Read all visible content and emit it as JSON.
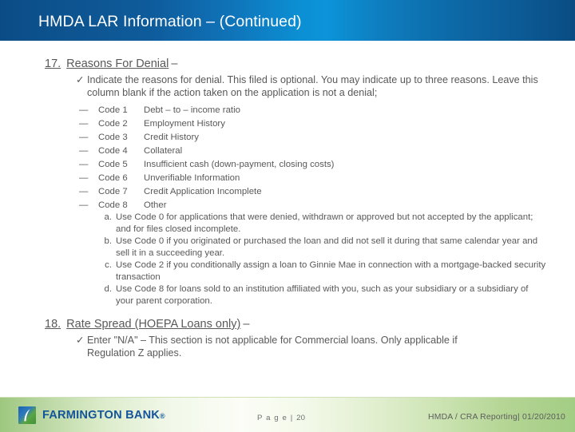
{
  "slide": {
    "title": "HMDA LAR Information – (Continued)"
  },
  "items": [
    {
      "number": "17.",
      "title": "Reasons For Denial",
      "dash": "–",
      "bullet_icon": "check-icon",
      "bullet": "Indicate the reasons for denial.  This filed is optional. You may indicate up to three reasons. Leave this column blank if the action taken on the application is not a denial;",
      "codes": [
        {
          "dash": "—",
          "code": "Code 1",
          "desc": "Debt – to – income ratio"
        },
        {
          "dash": "—",
          "code": "Code 2",
          "desc": "Employment History"
        },
        {
          "dash": "—",
          "code": "Code 3",
          "desc": "Credit History"
        },
        {
          "dash": "—",
          "code": "Code 4",
          "desc": "Collateral"
        },
        {
          "dash": "—",
          "code": "Code 5",
          "desc": "Insufficient cash (down-payment, closing costs)"
        },
        {
          "dash": "—",
          "code": "Code 6",
          "desc": "Unverifiable Information"
        },
        {
          "dash": "—",
          "code": "Code 7",
          "desc": "Credit Application Incomplete"
        },
        {
          "dash": "—",
          "code": "Code 8",
          "desc": "Other"
        }
      ],
      "letters": [
        {
          "label": "a.",
          "text": "Use Code 0 for applications that were denied, withdrawn or approved but not accepted by the applicant; and for files closed incomplete."
        },
        {
          "label": "b.",
          "text": "Use Code 0 if you originated or purchased the loan and did not sell it during that same calendar year and sell it in a succeeding year."
        },
        {
          "label": "c.",
          "text": "Use Code 2 if you conditionally assign a loan to Ginnie Mae in connection with a mortgage-backed security transaction"
        },
        {
          "label": "d.",
          "text": "Use Code 8 for loans sold to an institution affiliated with you, such as your subsidiary or a subsidiary of your parent corporation."
        }
      ]
    },
    {
      "number": "18.",
      "title": "Rate Spread (HOEPA Loans only)",
      "dash": "–",
      "bullet_icon": "check-icon",
      "bullet": "Enter \"N/A\" – This section is not applicable for Commercial loans. Only applicable if Regulation  Z applies."
    }
  ],
  "footer": {
    "logo_icon": "farmington-bank-leaf-logo",
    "wordmark": "FARMINGTON BANK",
    "wordmark_tm": "®",
    "page_label": "P a g e |",
    "page_number": "20",
    "right_text": "HMDA / CRA Reporting| 01/20/2010"
  },
  "colors": {
    "title_bar_dark": "#0b4c86",
    "title_bar_bright": "#0c93d8",
    "body_text": "#595959",
    "footer_green": "#9dc77f",
    "brand_blue": "#15549a"
  }
}
